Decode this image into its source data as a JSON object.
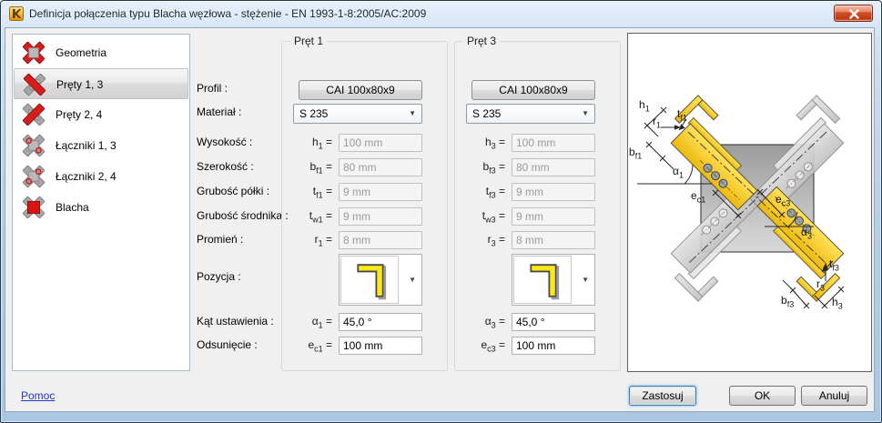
{
  "window": {
    "title": "Definicja połączenia typu Blacha węzłowa - stężenie  - EN 1993-1-8:2005/AC:2009"
  },
  "icons": {
    "close": "✕",
    "dropdown_arrow": "▼"
  },
  "colors": {
    "titlebar_blue": "#b9d1ea",
    "client_gray": "#f0f0f0",
    "icon_red": "#da1b1b",
    "member_yellow": "#f7cf17",
    "link_blue": "#2336c9",
    "close_red": "#c23a17"
  },
  "sidebar": {
    "selected_index": 1,
    "items": [
      {
        "label": "Geometria"
      },
      {
        "label": "Pręty 1, 3"
      },
      {
        "label": "Pręty 2, 4"
      },
      {
        "label": "Łączniki 1, 3"
      },
      {
        "label": "Łączniki 2, 4"
      },
      {
        "label": "Blacha"
      }
    ]
  },
  "field_labels": [
    "Profil :",
    "Materiał :",
    "Wysokość :",
    "Szerokość :",
    "Grubość półki :",
    "Grubość środnika :",
    "Promień :",
    "Pozycja :",
    "Kąt ustawienia :",
    "Odsunięcie :"
  ],
  "eq": "=",
  "panels": [
    {
      "title": "Pręt 1",
      "profile": "CAI 100x80x9",
      "material": "S 235",
      "rows": [
        {
          "sym": "h",
          "sub": "1",
          "value": "100 mm"
        },
        {
          "sym": "b",
          "sub": "f1",
          "value": "80 mm"
        },
        {
          "sym": "t",
          "sub": "f1",
          "value": "9 mm"
        },
        {
          "sym": "t",
          "sub": "w1",
          "value": "9 mm"
        },
        {
          "sym": "r",
          "sub": "1",
          "value": "8 mm"
        }
      ],
      "angle": {
        "sym": "α",
        "sub": "1",
        "value": "45,0 °"
      },
      "offset": {
        "sym": "e",
        "sub": "c1",
        "value": "100 mm"
      }
    },
    {
      "title": "Pręt 3",
      "profile": "CAI 100x80x9",
      "material": "S 235",
      "rows": [
        {
          "sym": "h",
          "sub": "3",
          "value": "100 mm"
        },
        {
          "sym": "b",
          "sub": "f3",
          "value": "80 mm"
        },
        {
          "sym": "t",
          "sub": "f3",
          "value": "9 mm"
        },
        {
          "sym": "t",
          "sub": "w3",
          "value": "9 mm"
        },
        {
          "sym": "r",
          "sub": "3",
          "value": "8 mm"
        }
      ],
      "angle": {
        "sym": "α",
        "sub": "3",
        "value": "45,0 °"
      },
      "offset": {
        "sym": "e",
        "sub": "c3",
        "value": "100 mm"
      }
    }
  ],
  "preview_labels": {
    "h1": {
      "sym": "h",
      "sub": "1"
    },
    "tf1": {
      "sym": "t",
      "sub": "f1"
    },
    "r1": {
      "sym": "r",
      "sub": "1"
    },
    "bf1": {
      "sym": "b",
      "sub": "f1"
    },
    "a1": {
      "sym": "α",
      "sub": "1"
    },
    "ec1": {
      "sym": "e",
      "sub": "c1"
    },
    "ec3": {
      "sym": "e",
      "sub": "c3"
    },
    "a3": {
      "sym": "α",
      "sub": "3"
    },
    "tf3": {
      "sym": "t",
      "sub": "f3"
    },
    "r3": {
      "sym": "r",
      "sub": "3"
    },
    "bf3": {
      "sym": "b",
      "sub": "f3"
    },
    "h3": {
      "sym": "h",
      "sub": "3"
    }
  },
  "footer": {
    "help": "Pomoc",
    "apply": "Zastosuj",
    "ok": "OK",
    "cancel": "Anuluj"
  }
}
